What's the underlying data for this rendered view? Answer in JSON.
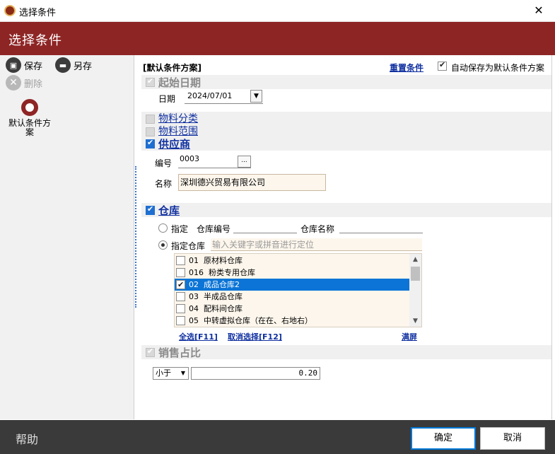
{
  "window": {
    "title": "选择条件",
    "close_glyph": "✕"
  },
  "header": {
    "title": "选择条件"
  },
  "toolbar": {
    "save_label": "保存",
    "save_as_label": "另存",
    "delete_label": "删除",
    "default_scheme_label": "默认条件方案"
  },
  "top": {
    "scheme_title": "[默认条件方案]",
    "reset_label": "重置条件",
    "autosave_label": "自动保存为默认条件方案",
    "autosave_checked": true
  },
  "start_date": {
    "title": "起始日期",
    "date_label": "日期",
    "date_value": "2024/07/01",
    "dropdown_glyph": "▼"
  },
  "material": {
    "category_label": "物料分类",
    "range_label": "物料范围"
  },
  "supplier": {
    "title": "供应商",
    "code_label": "编号",
    "code_value": "0003",
    "browse_glyph": "...",
    "name_label": "名称",
    "name_value": "深圳德兴贸易有限公司"
  },
  "warehouse": {
    "title": "仓库",
    "specify_label": "指定",
    "code_label": "仓库编号",
    "name_label": "仓库名称",
    "specify_wh_label": "指定仓库",
    "search_placeholder": "输入关键字或拼音进行定位",
    "items": [
      {
        "code": "01",
        "name": "原材料仓库",
        "checked": false,
        "selected": false
      },
      {
        "code": "016",
        "name": "粉类专用仓库",
        "checked": false,
        "selected": false
      },
      {
        "code": "02",
        "name": "成品仓库2",
        "checked": true,
        "selected": true
      },
      {
        "code": "03",
        "name": "半成品仓库",
        "checked": false,
        "selected": false
      },
      {
        "code": "04",
        "name": "配料间仓库",
        "checked": false,
        "selected": false
      },
      {
        "code": "05",
        "name": "中转虚拟仓库（在在、右地右）",
        "checked": false,
        "selected": false
      }
    ],
    "select_all_label": "全选[F11]",
    "deselect_label": "取消选择[F12]",
    "fullscreen_label": "满屏"
  },
  "sales_ratio": {
    "title": "销售占比",
    "operator": "小于",
    "value": "0.20"
  },
  "footer": {
    "help_label": "帮助",
    "ok_label": "确定",
    "cancel_label": "取消"
  },
  "colors": {
    "header_bg": "#8e2525",
    "link": "#1030a0",
    "selection": "#0b74d6",
    "footer_bg": "#3a3a3a"
  }
}
